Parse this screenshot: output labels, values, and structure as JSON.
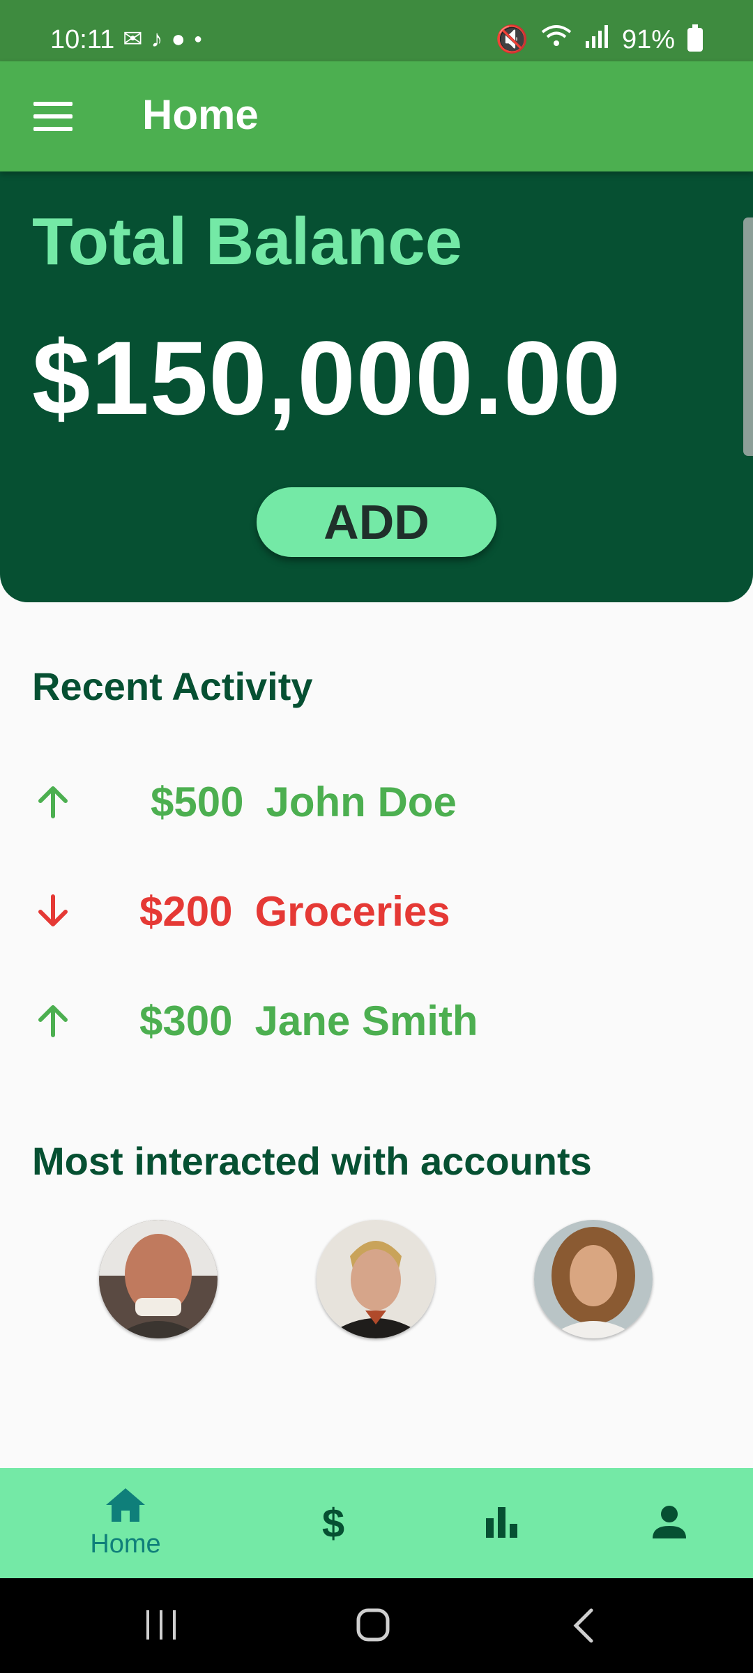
{
  "status_bar": {
    "time": "10:11",
    "battery": "91%"
  },
  "app_bar": {
    "title": "Home"
  },
  "balance": {
    "label": "Total Balance",
    "value": "$150,000.00",
    "add_label": "ADD"
  },
  "recent_activity": {
    "title": "Recent Activity",
    "items": [
      {
        "direction": "up",
        "amount": "$500",
        "name": "John Doe",
        "color": "#4caf50"
      },
      {
        "direction": "down",
        "amount": "$200",
        "name": "Groceries",
        "color": "#e53935"
      },
      {
        "direction": "up",
        "amount": "$300",
        "name": "Jane Smith",
        "color": "#4caf50"
      }
    ]
  },
  "accounts": {
    "title": "Most interacted with accounts"
  },
  "bottom_nav": {
    "items": [
      {
        "icon": "home-icon",
        "label": "Home",
        "active": true
      },
      {
        "icon": "dollar-icon",
        "label": ""
      },
      {
        "icon": "bar-chart-icon",
        "label": ""
      },
      {
        "icon": "person-icon",
        "label": ""
      }
    ]
  },
  "colors": {
    "status_bar": "#3e8b3f",
    "app_bar": "#4caf50",
    "card": "#065032",
    "accent": "#74e9a6",
    "positive": "#4caf50",
    "negative": "#e53935"
  }
}
